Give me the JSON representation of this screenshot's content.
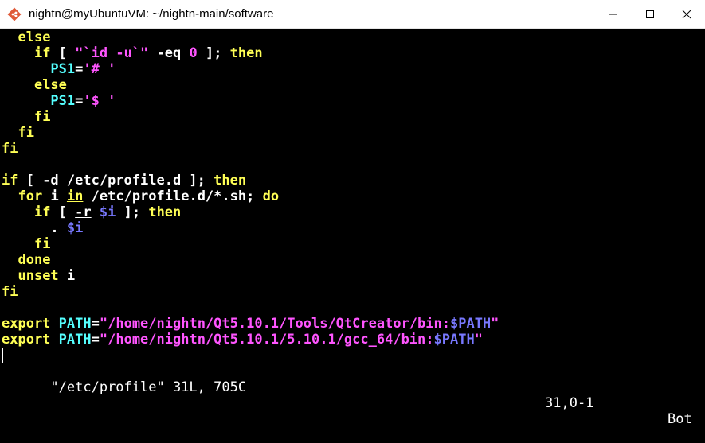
{
  "window": {
    "title": "nightn@myUbuntuVM: ~/nightn-main/software",
    "icons": [
      "git-icon",
      "minimize-icon",
      "maximize-icon",
      "close-icon"
    ]
  },
  "colors": {
    "keyword": "#ffff55",
    "variable": "#55ffff",
    "string": "#ff55ff",
    "dollar": "#7878ff",
    "text": "#ffffff",
    "background": "#000000"
  },
  "editor": {
    "lines": [
      [
        {
          "t": "  "
        },
        {
          "t": "else",
          "c": "yel"
        }
      ],
      [
        {
          "t": "    "
        },
        {
          "t": "if",
          "c": "yel"
        },
        {
          "t": " [ ",
          "c": "wht"
        },
        {
          "t": "\"`id -u`\"",
          "c": "mag"
        },
        {
          "t": " -eq ",
          "c": "wht"
        },
        {
          "t": "0",
          "c": "mag"
        },
        {
          "t": " ]; ",
          "c": "wht"
        },
        {
          "t": "then",
          "c": "yel"
        }
      ],
      [
        {
          "t": "      "
        },
        {
          "t": "PS1",
          "c": "cyn"
        },
        {
          "t": "=",
          "c": "wht"
        },
        {
          "t": "'# '",
          "c": "mag"
        }
      ],
      [
        {
          "t": "    "
        },
        {
          "t": "else",
          "c": "yel"
        }
      ],
      [
        {
          "t": "      "
        },
        {
          "t": "PS1",
          "c": "cyn"
        },
        {
          "t": "=",
          "c": "wht"
        },
        {
          "t": "'$ '",
          "c": "mag"
        }
      ],
      [
        {
          "t": "    "
        },
        {
          "t": "fi",
          "c": "yel"
        }
      ],
      [
        {
          "t": "  "
        },
        {
          "t": "fi",
          "c": "yel"
        }
      ],
      [
        {
          "t": "fi",
          "c": "yel"
        }
      ],
      [],
      [
        {
          "t": "if",
          "c": "yel"
        },
        {
          "t": " [ -d /etc/profile.d ]; ",
          "c": "wht"
        },
        {
          "t": "then",
          "c": "yel"
        }
      ],
      [
        {
          "t": "  "
        },
        {
          "t": "for",
          "c": "yel"
        },
        {
          "t": " i ",
          "c": "wht"
        },
        {
          "t": "in",
          "c": "yel",
          "u": true
        },
        {
          "t": " /etc/profile.d/*.sh; ",
          "c": "wht"
        },
        {
          "t": "do",
          "c": "yel"
        }
      ],
      [
        {
          "t": "    "
        },
        {
          "t": "if",
          "c": "yel"
        },
        {
          "t": " [ ",
          "c": "wht"
        },
        {
          "t": "-r",
          "c": "wht",
          "u": true
        },
        {
          "t": " ",
          "c": "wht"
        },
        {
          "t": "$i",
          "c": "blu"
        },
        {
          "t": " ]; ",
          "c": "wht"
        },
        {
          "t": "then",
          "c": "yel"
        }
      ],
      [
        {
          "t": "      "
        },
        {
          "t": ". ",
          "c": "wht"
        },
        {
          "t": "$i",
          "c": "blu"
        }
      ],
      [
        {
          "t": "    "
        },
        {
          "t": "fi",
          "c": "yel"
        }
      ],
      [
        {
          "t": "  "
        },
        {
          "t": "done",
          "c": "yel"
        }
      ],
      [
        {
          "t": "  "
        },
        {
          "t": "unset",
          "c": "yel"
        },
        {
          "t": " i",
          "c": "wht"
        }
      ],
      [
        {
          "t": "fi",
          "c": "yel"
        }
      ],
      [],
      [
        {
          "t": "export",
          "c": "yel"
        },
        {
          "t": " "
        },
        {
          "t": "PATH",
          "c": "cyn"
        },
        {
          "t": "=",
          "c": "wht"
        },
        {
          "t": "\"/home/nightn/Qt5.10.1/Tools/QtCreator/bin:",
          "c": "mag"
        },
        {
          "t": "$PATH",
          "c": "blu"
        },
        {
          "t": "\"",
          "c": "mag"
        }
      ],
      [
        {
          "t": "export",
          "c": "yel"
        },
        {
          "t": " "
        },
        {
          "t": "PATH",
          "c": "cyn"
        },
        {
          "t": "=",
          "c": "wht"
        },
        {
          "t": "\"/home/nightn/Qt5.10.1/5.10.1/gcc_64/bin:",
          "c": "mag"
        },
        {
          "t": "$PATH",
          "c": "blu"
        },
        {
          "t": "\"",
          "c": "mag"
        }
      ]
    ],
    "status": {
      "file": "\"/etc/profile\" 31L, 705C",
      "position": "31,0-1",
      "scroll": "Bot"
    }
  }
}
